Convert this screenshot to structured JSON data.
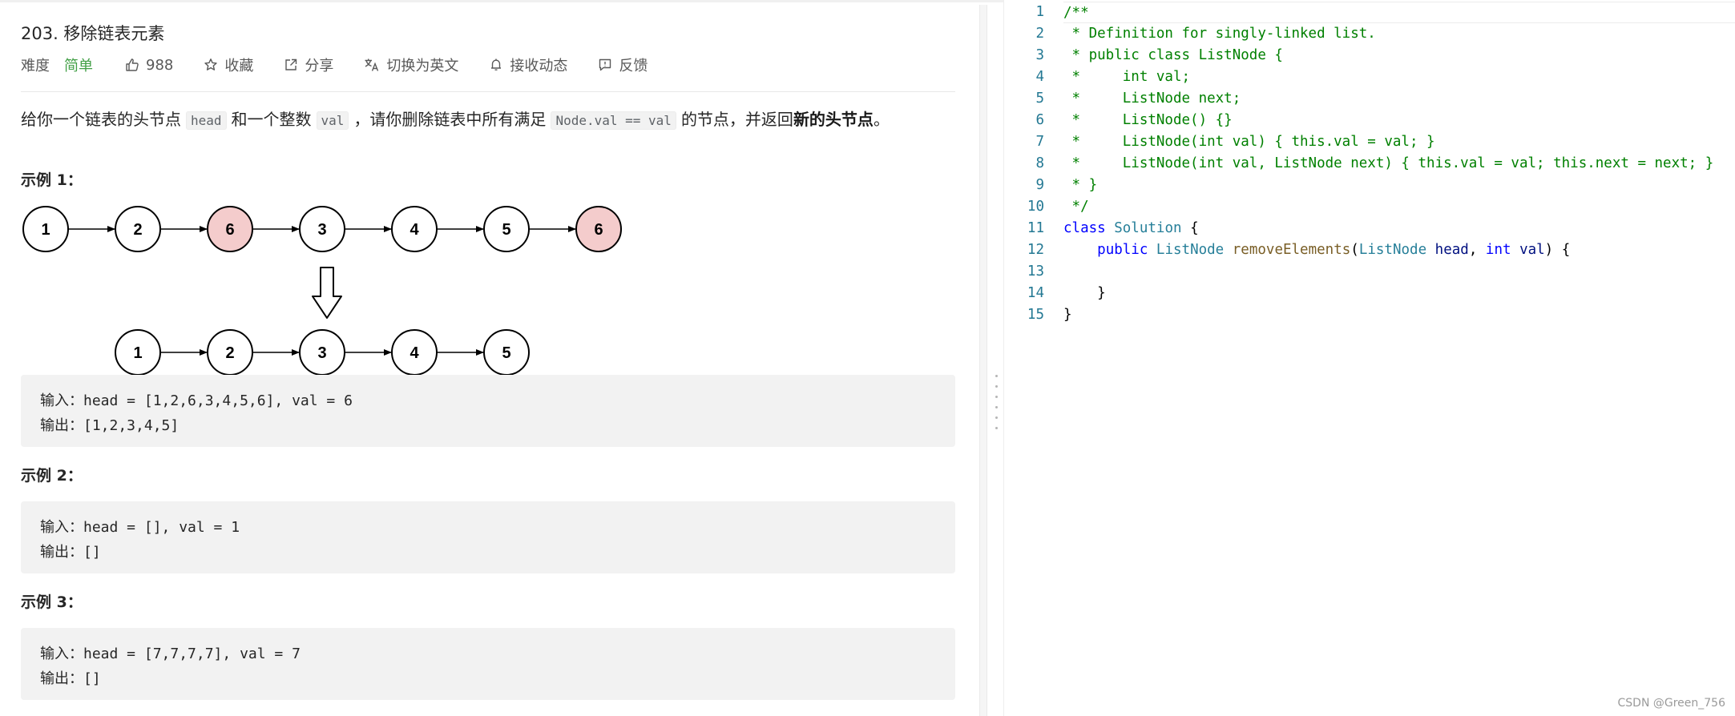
{
  "problem": {
    "title": "203. 移除链表元素",
    "difficulty_label": "难度",
    "difficulty": "简单",
    "likes": "988",
    "favorite": "收藏",
    "share": "分享",
    "switch_lang": "切换为英文",
    "subscribe": "接收动态",
    "feedback": "反馈",
    "description": {
      "p1": "给你一个链表的头节点",
      "code1": "head",
      "p2": "和一个整数",
      "code2": "val",
      "p3": "，请你删除链表中所有满足",
      "code3": "Node.val == val",
      "p4": "的节点，并返回",
      "bold": "新的头节点",
      "p5": "。"
    }
  },
  "diagram": {
    "top_nodes": [
      "1",
      "2",
      "6",
      "3",
      "4",
      "5",
      "6"
    ],
    "highlighted": [
      false,
      false,
      true,
      false,
      false,
      false,
      true
    ],
    "bottom_nodes": [
      "1",
      "2",
      "3",
      "4",
      "5"
    ],
    "node_color": "#ffffff",
    "highlight_color": "#f4cccc"
  },
  "examples": [
    {
      "title": "示例 1：",
      "input": "输入：head = [1,2,6,3,4,5,6], val = 6",
      "output": "输出：[1,2,3,4,5]"
    },
    {
      "title": "示例 2：",
      "input": "输入：head = [], val = 1",
      "output": "输出：[]"
    },
    {
      "title": "示例 3：",
      "input": "输入：head = [7,7,7,7], val = 7",
      "output": "输出：[]"
    }
  ],
  "editor": {
    "lines": [
      [
        [
          "c-comment",
          "/**"
        ]
      ],
      [
        [
          "c-comment",
          " * Definition for singly-linked list."
        ]
      ],
      [
        [
          "c-comment",
          " * public class ListNode {"
        ]
      ],
      [
        [
          "c-comment",
          " *     int val;"
        ]
      ],
      [
        [
          "c-comment",
          " *     ListNode next;"
        ]
      ],
      [
        [
          "c-comment",
          " *     ListNode() {}"
        ]
      ],
      [
        [
          "c-comment",
          " *     ListNode(int val) { this.val = val; }"
        ]
      ],
      [
        [
          "c-comment",
          " *     ListNode(int val, ListNode next) { this.val = val; this.next = next; }"
        ]
      ],
      [
        [
          "c-comment",
          " * }"
        ]
      ],
      [
        [
          "c-comment",
          " */"
        ]
      ],
      [
        [
          "c-kw",
          "class"
        ],
        [
          "c-plain",
          " "
        ],
        [
          "c-type",
          "Solution"
        ],
        [
          "c-plain",
          " {"
        ]
      ],
      [
        [
          "c-plain",
          "    "
        ],
        [
          "c-kw",
          "public"
        ],
        [
          "c-plain",
          " "
        ],
        [
          "c-type",
          "ListNode"
        ],
        [
          "c-plain",
          " "
        ],
        [
          "c-fn",
          "removeElements"
        ],
        [
          "c-plain",
          "("
        ],
        [
          "c-type",
          "ListNode"
        ],
        [
          "c-plain",
          " "
        ],
        [
          "c-var",
          "head"
        ],
        [
          "c-plain",
          ", "
        ],
        [
          "c-kw",
          "int"
        ],
        [
          "c-plain",
          " "
        ],
        [
          "c-var",
          "val"
        ],
        [
          "c-plain",
          ") {"
        ]
      ],
      [
        [
          "c-plain",
          ""
        ]
      ],
      [
        [
          "c-plain",
          "    }"
        ]
      ],
      [
        [
          "c-plain",
          "}"
        ]
      ]
    ]
  },
  "watermark": "CSDN @Green_756"
}
